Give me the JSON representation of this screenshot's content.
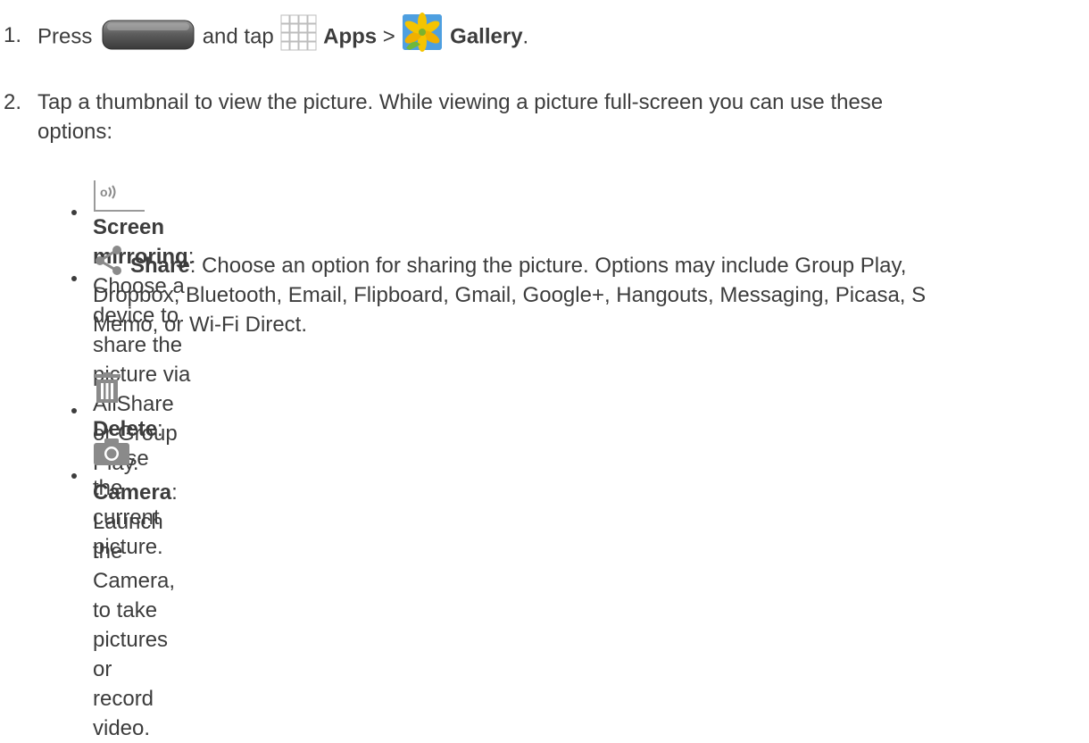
{
  "steps": [
    {
      "num": "1.",
      "press": "Press",
      "and_tap": "and tap",
      "apps": "Apps",
      "sep": ">",
      "gallery": "Gallery",
      "end": "."
    },
    {
      "num": "2.",
      "line1": "Tap a thumbnail to view the picture. While viewing a picture full-screen you can use these",
      "line2": "options:"
    }
  ],
  "options": [
    {
      "title": "Screen mirroring",
      "desc": ": Choose a device to share the picture via AllShare or Group Play.",
      "icon": "screen-mirroring-icon"
    },
    {
      "title": "Share",
      "desc1": ": Choose an option for sharing the picture. Options may include Group Play,",
      "desc2": "Dropbox, Bluetooth, Email, Flipboard, Gmail, Google+, Hangouts, Messaging, Picasa, S",
      "desc3": "Memo, or Wi-Fi Direct.",
      "icon": "share-icon"
    },
    {
      "title": "Delete",
      "desc": ": Erase the current picture.",
      "icon": "trash-icon"
    },
    {
      "title": "Camera",
      "desc": ": Launch the Camera, to take pictures or record video.",
      "icon": "camera-icon"
    }
  ],
  "colors": {
    "text": "#3c3c3c",
    "icon_gray": "#8a8a8a",
    "gallery_yellow": "#f5c400",
    "gallery_blue": "#3d8fd6"
  }
}
